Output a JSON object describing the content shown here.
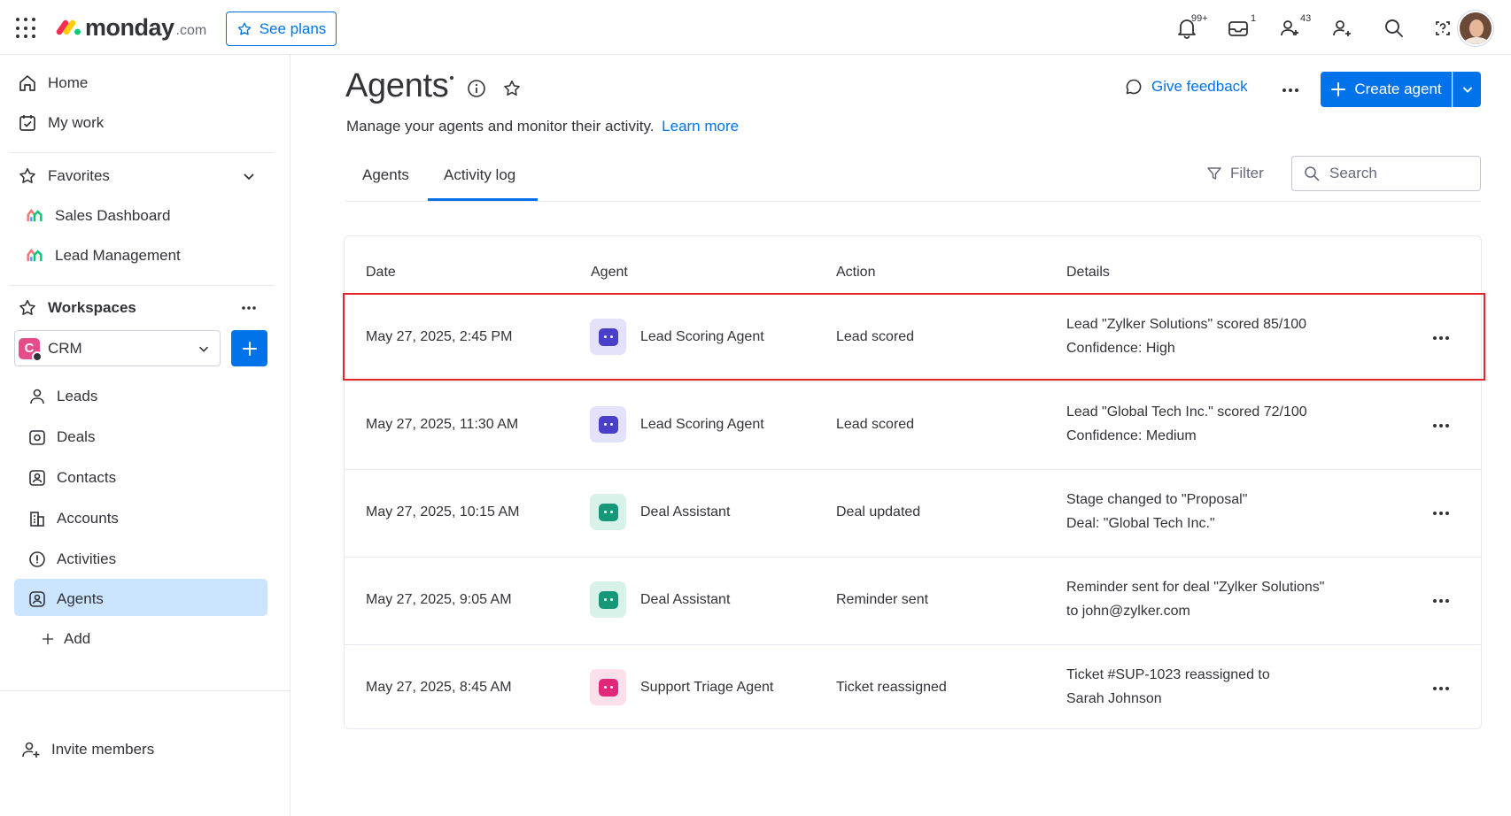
{
  "topbar": {
    "logo_word": "monday",
    "logo_suffix": ".com",
    "see_plans": "See plans",
    "notifications_badge": "99+",
    "inbox_badge": "1",
    "team_badge": "43",
    "icons": [
      "apps-grid-icon",
      "bell-icon",
      "inbox-icon",
      "team-icon",
      "invite-icon",
      "search-icon",
      "help-icon",
      "avatar"
    ]
  },
  "sidebar": {
    "home": "Home",
    "my_work": "My work",
    "favorites": "Favorites",
    "fav_items": [
      "Sales Dashboard",
      "Lead Management"
    ],
    "workspaces": "Workspaces",
    "workspace_badge": "C",
    "workspace_name": "CRM",
    "items": [
      "Leads",
      "Deals",
      "Contacts",
      "Accounts",
      "Activities",
      "Agents"
    ],
    "add": "Add",
    "invite": "Invite members"
  },
  "main": {
    "title": "Agents",
    "subtitle": "Manage your agents and monitor their activity.",
    "learn_more": "Learn more",
    "give_feedback": "Give feedback",
    "create_agent": "Create agent",
    "tabs": [
      "Agents",
      "Activity log"
    ],
    "active_tab": "Activity log",
    "filter": "Filter",
    "search_placeholder": "Search"
  },
  "table": {
    "headers": [
      "Date",
      "Agent",
      "Action",
      "Details"
    ],
    "rows": [
      {
        "date": "May 27, 2025, 2:45 PM",
        "agent": "Lead Scoring Agent",
        "action": "Lead scored",
        "detail_1": "Lead \"Zylker Solutions\" scored 85/100",
        "detail_2": "Confidence: High",
        "icon_color": "#4a3fc8",
        "icon_bg": "#e4e1fb"
      },
      {
        "date": "May 27, 2025, 11:30 AM",
        "agent": "Lead Scoring Agent",
        "action": "Lead scored",
        "detail_1": "Lead \"Global Tech Inc.\" scored 72/100",
        "detail_2": "Confidence: Medium",
        "icon_color": "#4a3fc8",
        "icon_bg": "#e4e1fb"
      },
      {
        "date": "May 27, 2025, 10:15 AM",
        "agent": "Deal Assistant",
        "action": "Deal updated",
        "detail_1": "Stage changed to \"Proposal\"",
        "detail_2": "Deal: \"Global Tech Inc.\"",
        "icon_color": "#15987a",
        "icon_bg": "#d8f2ea"
      },
      {
        "date": "May 27, 2025, 9:05 AM",
        "agent": "Deal Assistant",
        "action": "Reminder sent",
        "detail_1": "Reminder sent for deal \"Zylker Solutions\"",
        "detail_2": "to john@zylker.com",
        "icon_color": "#15987a",
        "icon_bg": "#d8f2ea"
      },
      {
        "date": "May 27, 2025, 8:45 AM",
        "agent": "Support Triage Agent",
        "action": "Ticket reassigned",
        "detail_1": "Ticket #SUP-1023 reassigned to",
        "detail_2": "Sarah Johnson",
        "icon_color": "#e2287a",
        "icon_bg": "#fbe0ec"
      }
    ]
  },
  "colors": {
    "accent": "#0073ea",
    "selected_row_outline": "#e2262a",
    "active_nav_bg": "#cce5ff"
  }
}
